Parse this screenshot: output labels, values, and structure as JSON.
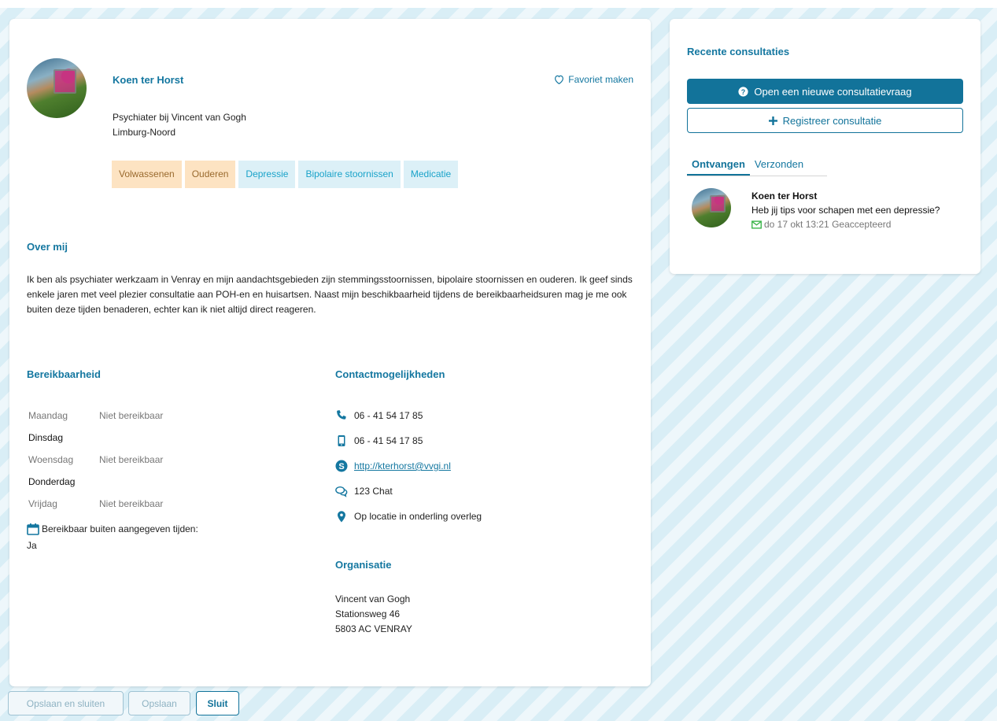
{
  "colors": {
    "accent": "#12739a",
    "link": "#1477a0",
    "tag_orange_bg": "#fde3c2",
    "tag_blue_bg": "#dcf0f7",
    "accepted_green": "#3cb54a"
  },
  "profile": {
    "name": "Koen ter Horst",
    "favorite_label": "Favoriet maken",
    "job_line1": "Psychiater bij Vincent van Gogh",
    "job_line2": "Limburg-Noord",
    "tags": [
      {
        "label": "Volwassenen",
        "style": "orange"
      },
      {
        "label": "Ouderen",
        "style": "orange"
      },
      {
        "label": "Depressie",
        "style": "blue"
      },
      {
        "label": "Bipolaire stoornissen",
        "style": "blue"
      },
      {
        "label": "Medicatie",
        "style": "blue"
      }
    ]
  },
  "about": {
    "title": "Over mij",
    "text": "Ik ben als psychiater werkzaam in Venray en mijn aandachtsgebieden zijn stemmingsstoornissen, bipolaire stoornissen en ouderen. Ik geef sinds enkele jaren met veel plezier consultatie aan POH-en en huisartsen. Naast mijn beschikbaarheid tijdens de bereikbaarheidsuren mag je me ook buiten deze tijden benaderen, echter kan ik niet altijd direct reageren."
  },
  "availability": {
    "title": "Bereikbaarheid",
    "days": [
      {
        "day": "Maandag",
        "status": "Niet bereikbaar"
      },
      {
        "day": "Dinsdag",
        "status": ""
      },
      {
        "day": "Woensdag",
        "status": "Niet bereikbaar"
      },
      {
        "day": "Donderdag",
        "status": ""
      },
      {
        "day": "Vrijdag",
        "status": "Niet bereikbaar"
      }
    ],
    "outside_label": "Bereikbaar buiten aangegeven tijden:",
    "outside_value": "Ja"
  },
  "contact": {
    "title": "Contactmogelijkheden",
    "phone": "06 - 41 54 17 85",
    "mobile": "06 - 41 54 17 85",
    "skype": "http://kterhorst@vvgi.nl",
    "chat": "123 Chat",
    "location": "Op locatie in onderling overleg"
  },
  "organisation": {
    "title": "Organisatie",
    "name": "Vincent van Gogh",
    "street": "Stationsweg 46",
    "city": "5803 AC VENRAY"
  },
  "sidebar": {
    "title": "Recente consultaties",
    "new_question_label": "Open een nieuwe consultatievraag",
    "register_label": "Registreer consultatie",
    "tabs": [
      {
        "label": "Ontvangen"
      },
      {
        "label": "Verzonden"
      }
    ],
    "message": {
      "from": "Koen ter Horst",
      "text": "Heb jij tips voor schapen met een depressie?",
      "meta": "do 17 okt 13:21 Geaccepteerd"
    }
  },
  "footer": {
    "save_close_label": "Opslaan en sluiten",
    "save_label": "Opslaan",
    "close_label": "Sluit"
  }
}
